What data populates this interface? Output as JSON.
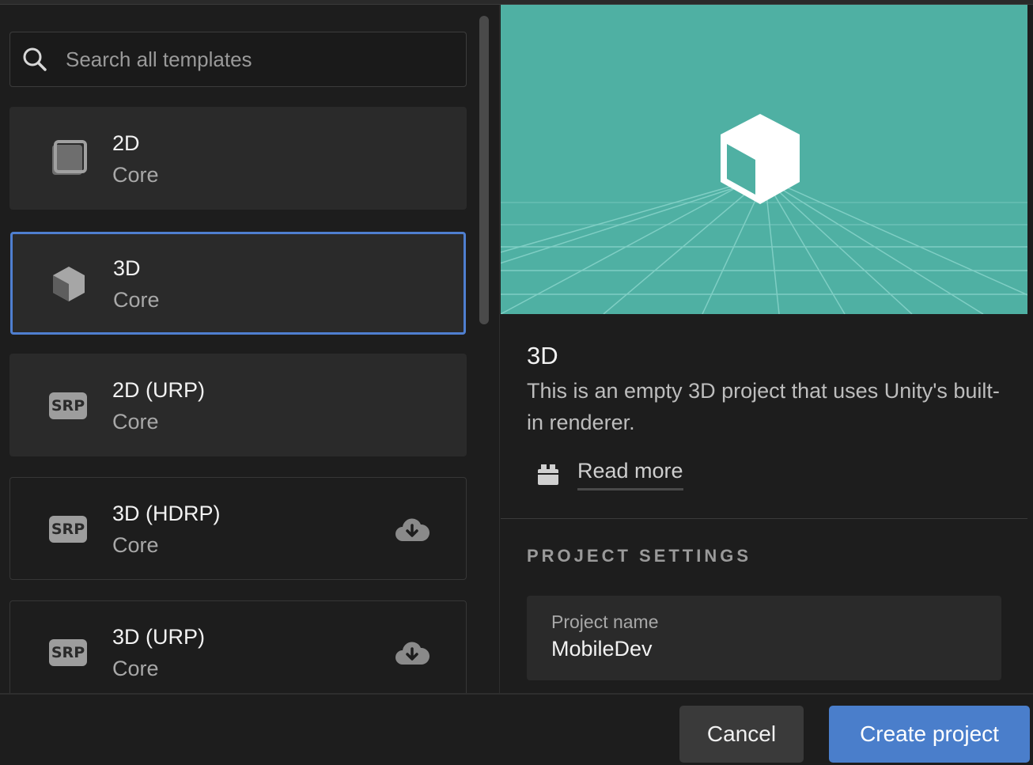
{
  "search": {
    "placeholder": "Search all templates",
    "icon": "search-icon"
  },
  "templates": [
    {
      "title": "2D",
      "subtitle": "Core",
      "icon": "square-2d-icon",
      "selected": false,
      "download": false
    },
    {
      "title": "3D",
      "subtitle": "Core",
      "icon": "cube-3d-icon",
      "selected": true,
      "download": false
    },
    {
      "title": "2D (URP)",
      "subtitle": "Core",
      "icon": "srp-badge",
      "badge": "SRP",
      "selected": false,
      "download": false
    },
    {
      "title": "3D (HDRP)",
      "subtitle": "Core",
      "icon": "srp-badge",
      "badge": "SRP",
      "selected": false,
      "download": true
    },
    {
      "title": "3D (URP)",
      "subtitle": "Core",
      "icon": "srp-badge",
      "badge": "SRP",
      "selected": false,
      "download": true
    }
  ],
  "details": {
    "title": "3D",
    "description": "This is an empty 3D project that uses Unity's built-in renderer.",
    "read_more": "Read more",
    "preview_color": "#4fb0a3"
  },
  "settings": {
    "heading": "PROJECT SETTINGS",
    "project_name_label": "Project name",
    "project_name_value": "MobileDev"
  },
  "footer": {
    "cancel_label": "Cancel",
    "create_label": "Create project"
  },
  "colors": {
    "accent": "#4a7ecb",
    "selected_border": "#4f7fd0",
    "background": "#1d1d1d",
    "card": "#2a2a2a"
  }
}
